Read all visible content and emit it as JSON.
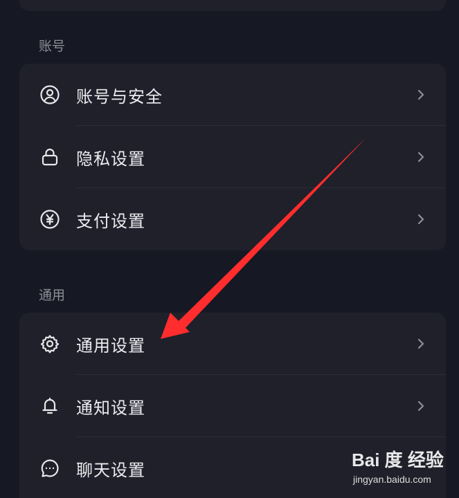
{
  "sections": [
    {
      "title": "账号",
      "items": [
        {
          "label": "账号与安全",
          "icon": "user-circle-icon"
        },
        {
          "label": "隐私设置",
          "icon": "lock-icon"
        },
        {
          "label": "支付设置",
          "icon": "yen-circle-icon"
        }
      ]
    },
    {
      "title": "通用",
      "items": [
        {
          "label": "通用设置",
          "icon": "gear-icon"
        },
        {
          "label": "通知设置",
          "icon": "bell-icon"
        },
        {
          "label": "聊天设置",
          "icon": "chat-bubble-icon"
        }
      ]
    }
  ],
  "watermark": {
    "brand": "Bai 度 经验",
    "url": "jingyan.baidu.com"
  },
  "colors": {
    "background": "#161823",
    "card": "#1f2029",
    "arrow": "#ff2d2d",
    "section_title": "#8e8f97"
  }
}
